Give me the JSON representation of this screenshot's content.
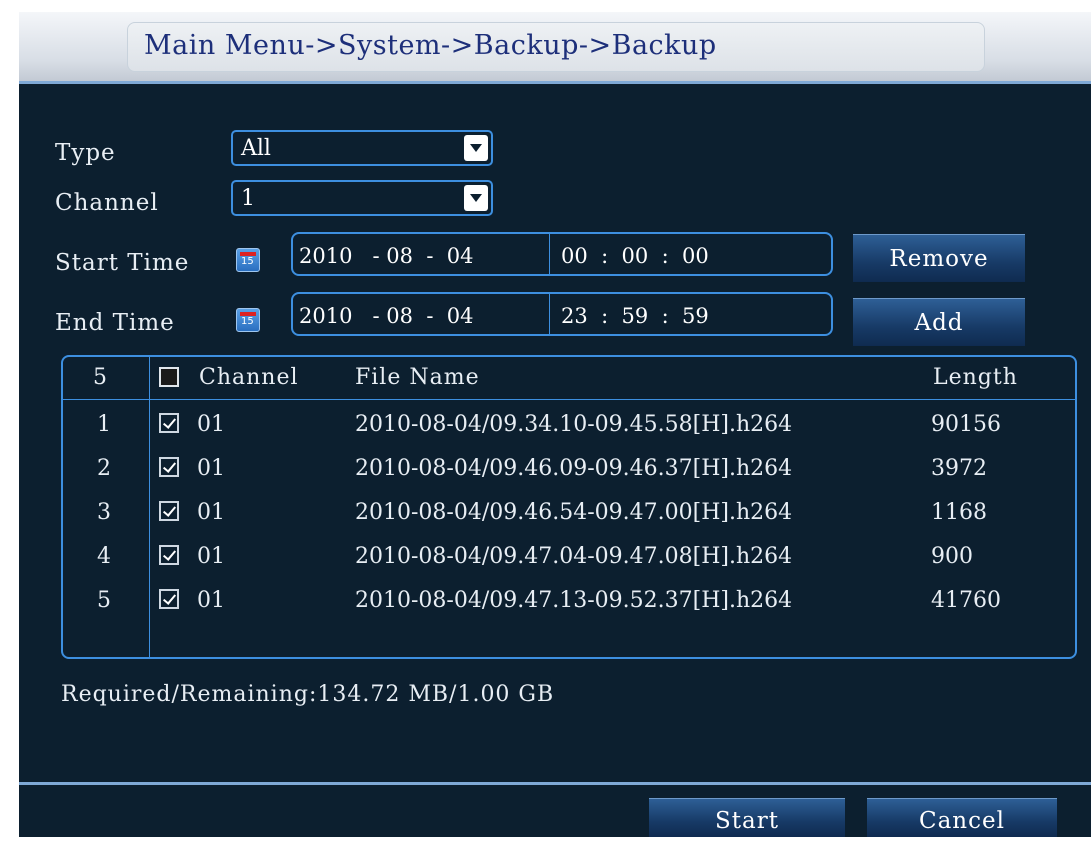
{
  "title": "Main Menu->System->Backup->Backup",
  "form": {
    "type_label": "Type",
    "type_value": "All",
    "channel_label": "Channel",
    "channel_value": "1",
    "start_label": "Start Time",
    "start_date": "2010   - 08  -  04",
    "start_time": "00  :  00  :  00",
    "end_label": "End Time",
    "end_date": "2010   - 08  -  04",
    "end_time": "23  :  59  :  59"
  },
  "buttons": {
    "remove": "Remove",
    "add": "Add",
    "start": "Start",
    "cancel": "Cancel"
  },
  "table": {
    "count": "5",
    "headers": {
      "channel": "Channel",
      "file": "File Name",
      "length": "Length"
    },
    "rows": [
      {
        "index": "1",
        "channel": "01",
        "file": "2010-08-04/09.34.10-09.45.58[H].h264",
        "length": "90156",
        "checked": true
      },
      {
        "index": "2",
        "channel": "01",
        "file": "2010-08-04/09.46.09-09.46.37[H].h264",
        "length": "3972",
        "checked": true
      },
      {
        "index": "3",
        "channel": "01",
        "file": "2010-08-04/09.46.54-09.47.00[H].h264",
        "length": "1168",
        "checked": true
      },
      {
        "index": "4",
        "channel": "01",
        "file": "2010-08-04/09.47.04-09.47.08[H].h264",
        "length": "900",
        "checked": true
      },
      {
        "index": "5",
        "channel": "01",
        "file": "2010-08-04/09.47.13-09.52.37[H].h264",
        "length": "41760",
        "checked": true
      }
    ]
  },
  "status": "Required/Remaining:134.72 MB/1.00 GB",
  "colors": {
    "background": "#0c1f2f",
    "accent": "#3d8fe0",
    "title_text": "#1d2f7a"
  },
  "icons": {
    "calendar": "calendar-icon",
    "dropdown": "chevron-down-icon",
    "checkbox": "checkbox-icon"
  }
}
